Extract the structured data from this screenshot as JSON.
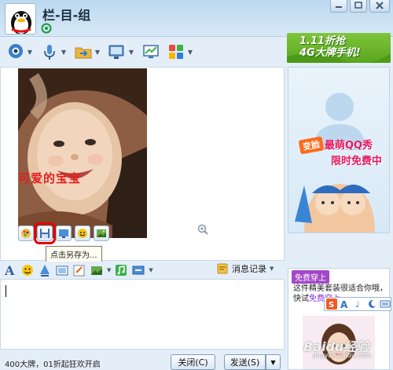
{
  "window": {
    "title": "栏-目-组"
  },
  "toolbar": {
    "items": [
      {
        "icon": "webcam-icon"
      },
      {
        "icon": "microphone-icon"
      },
      {
        "icon": "file-transfer-icon"
      },
      {
        "icon": "remote-desktop-icon"
      },
      {
        "icon": "screen-share-icon"
      },
      {
        "icon": "apps-icon"
      }
    ]
  },
  "ad_top": {
    "line1": "1.11折抢",
    "line2": "4G大牌手机!"
  },
  "message": {
    "photo_caption": "可爱的宝宝",
    "tooltip": "点击另存为..."
  },
  "ad_right": {
    "badge": "变脸",
    "line1": "最萌QQ秀",
    "line2": "限时免费中"
  },
  "formatbar": {
    "history_label": "消息记录"
  },
  "ad_lower": {
    "tag": "免费穿上",
    "text": "这件精美套装很适合你哦，快试",
    "link": "免费穿上"
  },
  "footer": {
    "notice": "400大牌，01折起狂欢开启",
    "close_button": "关闭(C)",
    "send_button": "发送(S)"
  },
  "watermark": {
    "main": "Baidu经验",
    "sub": "jingyan.baidu.com"
  },
  "colors": {
    "accent": "#e50000",
    "ad_green": "#6bb52a",
    "purple": "#a348c8"
  }
}
